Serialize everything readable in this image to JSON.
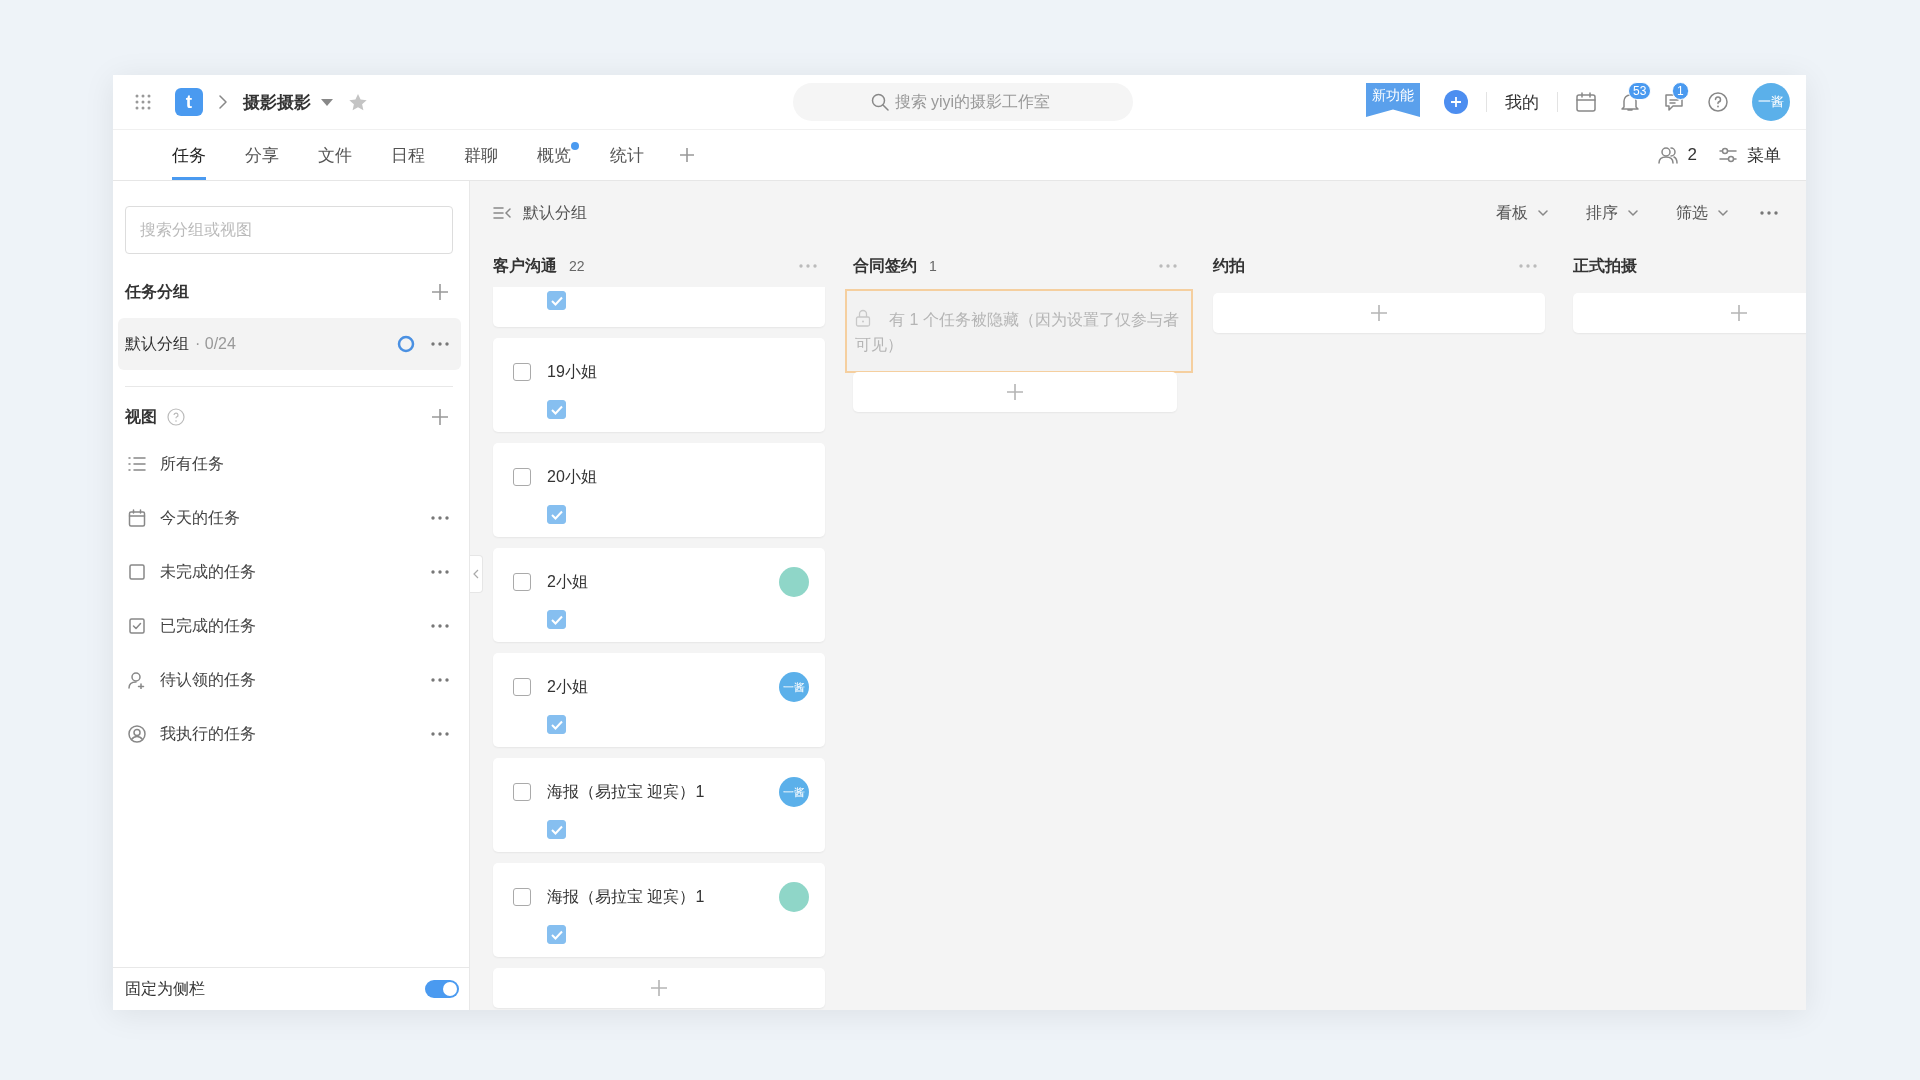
{
  "topbar": {
    "logo": "t",
    "project": "摄影摄影",
    "starred": false,
    "search": {
      "placeholder": "搜索 yiyi的摄影工作室"
    },
    "new_feature": "新功能",
    "mine": "我的",
    "notifications": "53",
    "messages": "1",
    "avatar_text": "一酱"
  },
  "tabs": [
    {
      "label": "任务",
      "selected": true,
      "dot": false
    },
    {
      "label": "分享",
      "selected": false,
      "dot": false
    },
    {
      "label": "文件",
      "selected": false,
      "dot": false
    },
    {
      "label": "日程",
      "selected": false,
      "dot": false
    },
    {
      "label": "群聊",
      "selected": false,
      "dot": false
    },
    {
      "label": "概览",
      "selected": false,
      "dot": true
    },
    {
      "label": "统计",
      "selected": false,
      "dot": false
    }
  ],
  "tab_tools": {
    "members": "2",
    "menu": "菜单"
  },
  "sidebar": {
    "search": {
      "placeholder": "搜索分组或视图"
    },
    "groups_title": "任务分组",
    "groups": [
      {
        "name": "默认分组",
        "progress": "· 0/24",
        "selected": true
      }
    ],
    "views_title": "视图",
    "views": [
      {
        "kind": "list",
        "label": "所有任务",
        "more": false
      },
      {
        "kind": "calendar",
        "label": "今天的任务",
        "more": true
      },
      {
        "kind": "square",
        "label": "未完成的任务",
        "more": true
      },
      {
        "kind": "checkbox",
        "label": "已完成的任务",
        "more": true
      },
      {
        "kind": "claim",
        "label": "待认领的任务",
        "more": true
      },
      {
        "kind": "mine",
        "label": "我执行的任务",
        "more": true
      }
    ],
    "pin": {
      "label": "固定为侧栏",
      "on": true
    }
  },
  "board": {
    "title": "默认分组",
    "controls": [
      {
        "label": "看板"
      },
      {
        "label": "排序"
      },
      {
        "label": "筛选"
      }
    ],
    "columns": [
      {
        "title": "客户沟通",
        "count": "22",
        "more": true,
        "cards": [
          {
            "kind": "partial",
            "subtask_checked": true
          },
          {
            "kind": "full",
            "title": "19小姐",
            "done": false,
            "subtask_checked": true
          },
          {
            "kind": "full",
            "title": "20小姐",
            "done": false,
            "subtask_checked": true
          },
          {
            "kind": "full",
            "title": "2小姐",
            "done": false,
            "subtask_checked": true,
            "avatar": {
              "kind": "picture"
            }
          },
          {
            "kind": "full",
            "title": "2小姐",
            "done": false,
            "subtask_checked": true,
            "avatar": {
              "kind": "initials",
              "text": "一酱"
            }
          },
          {
            "kind": "full",
            "title": "海报（易拉宝 迎宾）1",
            "done": false,
            "subtask_checked": true,
            "avatar": {
              "kind": "initials",
              "text": "一酱"
            }
          },
          {
            "kind": "full",
            "title": "海报（易拉宝 迎宾）1",
            "done": false,
            "subtask_checked": true,
            "avatar": {
              "kind": "picture"
            }
          }
        ]
      },
      {
        "title": "合同签约",
        "count": "1",
        "more": true,
        "notice": "有 1 个任务被隐藏（因为设置了仅参与者可见）"
      },
      {
        "title": "约拍",
        "more": true
      },
      {
        "title": "正式拍摄",
        "more": false
      }
    ]
  }
}
